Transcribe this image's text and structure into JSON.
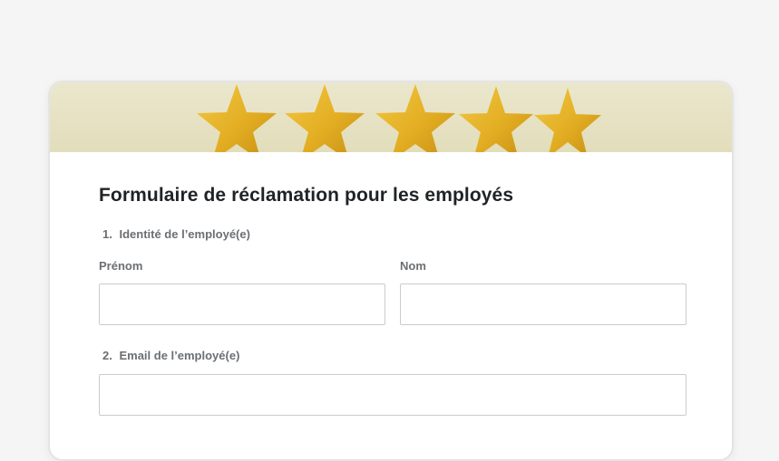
{
  "form": {
    "title": "Formulaire de réclamation pour les employés",
    "banner": {
      "icon": "five-gold-stars",
      "star_color": "#e6b325",
      "background_color": "#e6e2c4"
    },
    "questions": [
      {
        "number": "1.",
        "label": "Identité de l’employé(e)",
        "fields": [
          {
            "label": "Prénom",
            "value": "",
            "placeholder": ""
          },
          {
            "label": "Nom",
            "value": "",
            "placeholder": ""
          }
        ]
      },
      {
        "number": "2.",
        "label": "Email de l’employé(e)",
        "fields": [
          {
            "label": "",
            "value": "",
            "placeholder": ""
          }
        ]
      }
    ]
  }
}
